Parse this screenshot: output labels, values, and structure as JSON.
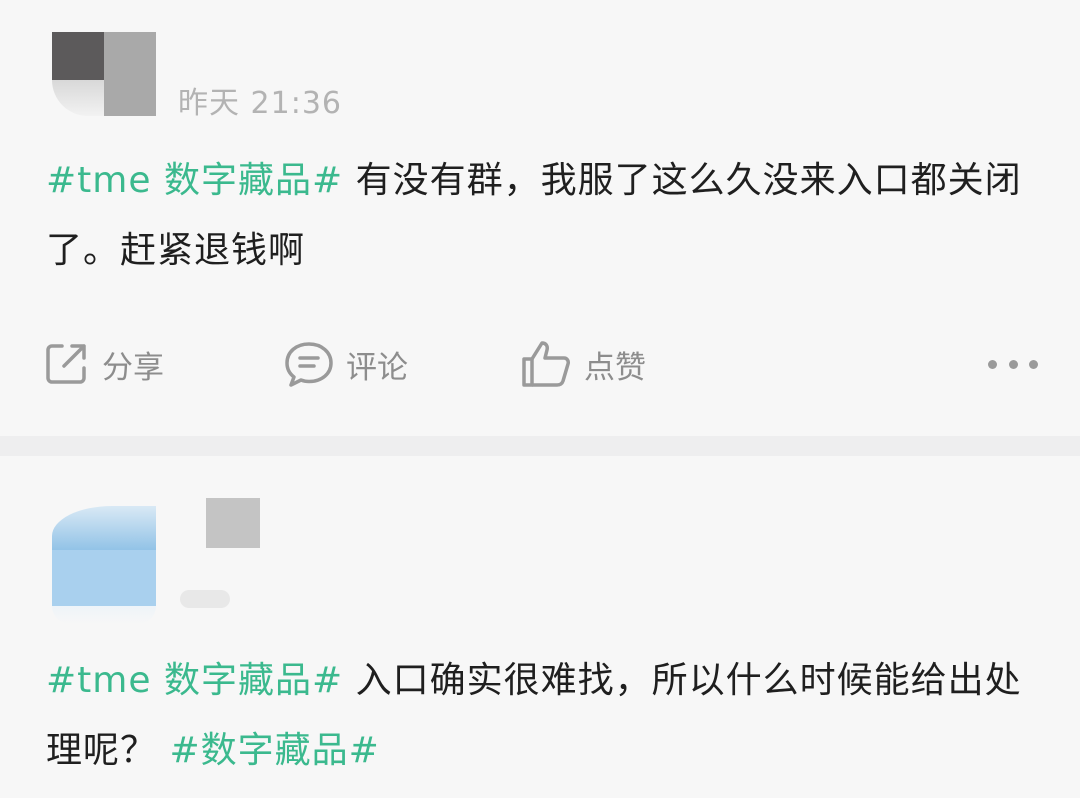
{
  "posts": [
    {
      "time": "昨天 21:36",
      "topic": "#tme 数字藏品#",
      "body": "有没有群，我服了这么久没来入口都关闭了。赶紧退钱啊",
      "actions": {
        "share": "分享",
        "comment": "评论",
        "like": "点赞"
      }
    },
    {
      "topic": "#tme 数字藏品#",
      "body": "入口确实很难找，所以什么时候能给出处理呢？",
      "topic_end": "#数字藏品#"
    }
  ],
  "icons": [
    "share-icon",
    "comment-icon",
    "like-icon",
    "more-icon"
  ],
  "colors": {
    "topic": "#3bb98e",
    "background": "#f7f7f7",
    "separator": "#eeeeef",
    "muted": "#8d8d8d"
  }
}
